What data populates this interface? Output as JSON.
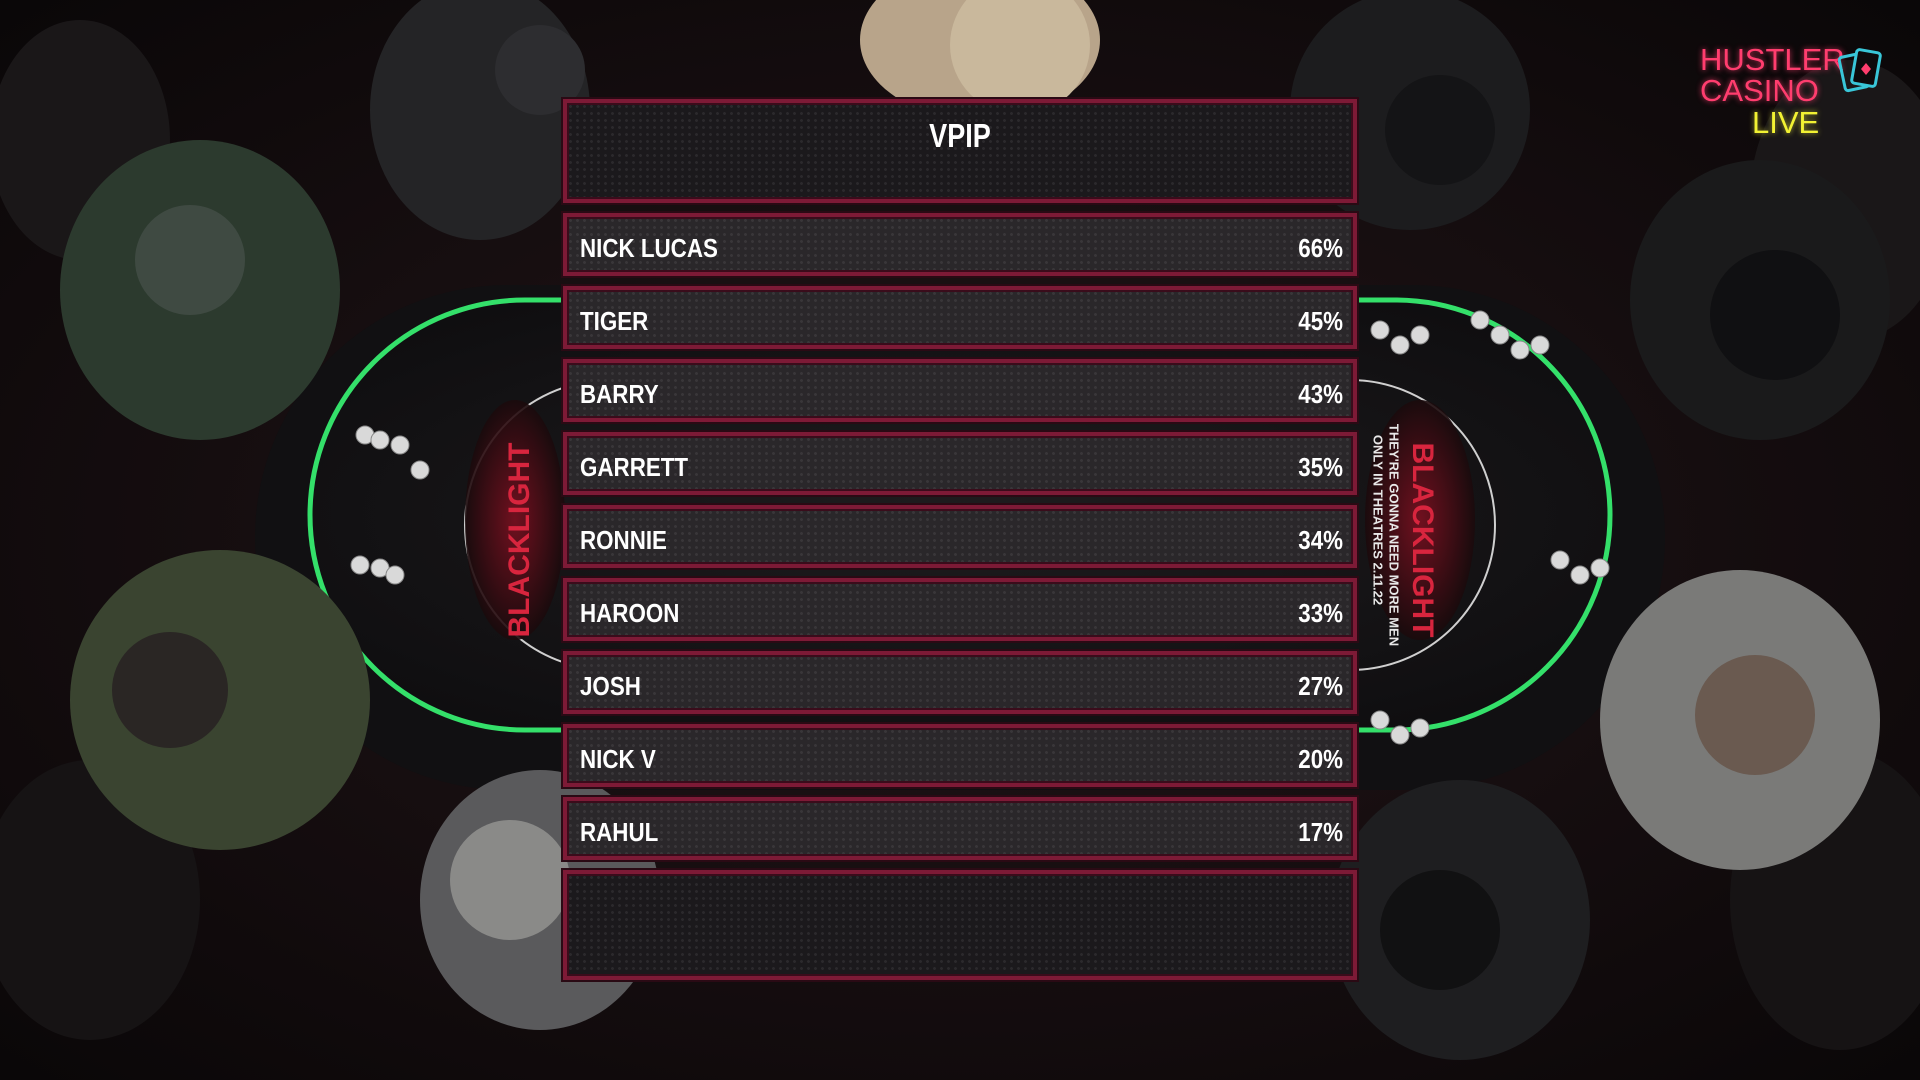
{
  "stat": {
    "title": "VPIP"
  },
  "players": [
    {
      "name": "NICK LUCAS",
      "value": "66%"
    },
    {
      "name": "TIGER",
      "value": "45%"
    },
    {
      "name": "BARRY",
      "value": "43%"
    },
    {
      "name": "GARRETT",
      "value": "35%"
    },
    {
      "name": "RONNIE",
      "value": "34%"
    },
    {
      "name": "HAROON",
      "value": "33%"
    },
    {
      "name": "JOSH",
      "value": "27%"
    },
    {
      "name": "NICK V",
      "value": "20%"
    },
    {
      "name": "RAHUL",
      "value": "17%"
    }
  ],
  "logo": {
    "line1": "HUSTLER",
    "line2": "CASINO",
    "line3": "LIVE",
    "icon": "playing-cards-icon"
  },
  "table_branding": {
    "left": "BLACKLIGHT",
    "right": "BLACKLIGHT",
    "right_tagline1": "THEY'RE GONNA NEED MORE MEN",
    "right_tagline2": "ONLY IN THEATRES 2.11.22"
  },
  "colors": {
    "panel_border": "#7d1a36",
    "felt_edge": "#34e06a",
    "logo_pink": "#ff3d6e",
    "logo_yellow": "#f2f233"
  }
}
